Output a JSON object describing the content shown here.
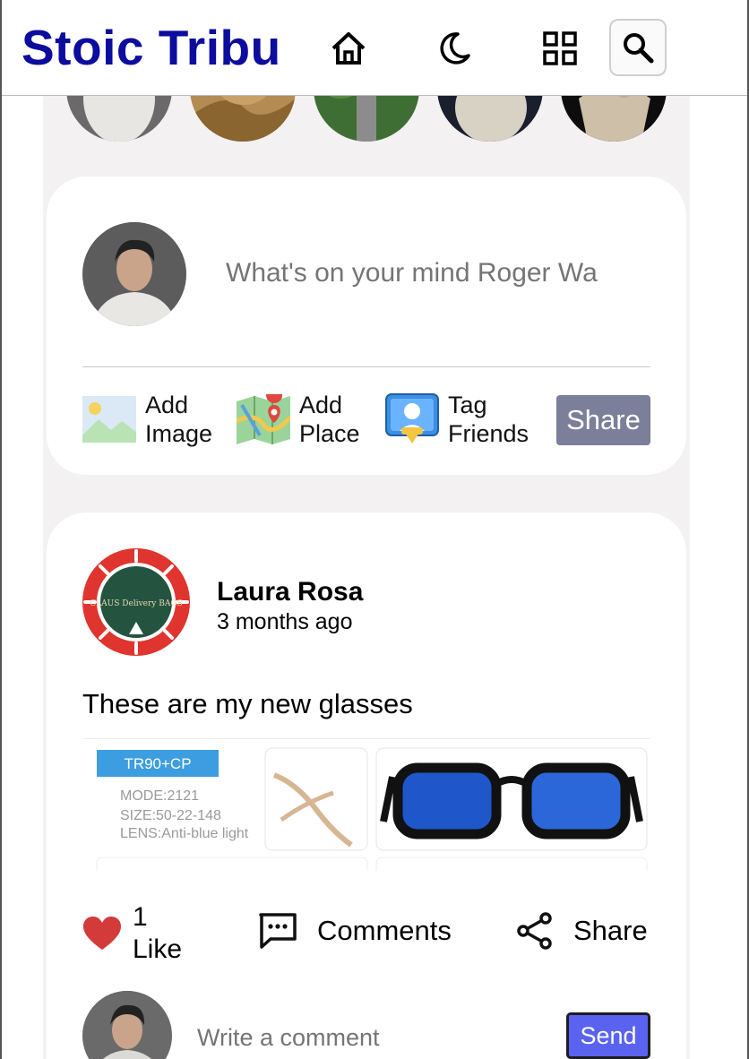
{
  "header": {
    "brand": "Stoic Tribu",
    "icons": [
      "home-icon",
      "moon-icon",
      "grid-icon",
      "search-icon"
    ]
  },
  "stories": {
    "count": 5
  },
  "composer": {
    "placeholder": "What's on your mind Roger Wa",
    "actions": [
      {
        "line1": "Add",
        "line2": "Image",
        "icon": "image-icon"
      },
      {
        "line1": "Add",
        "line2": "Place",
        "icon": "map-icon"
      },
      {
        "line1": "Tag",
        "line2": "Friends",
        "icon": "tag-friends-icon"
      }
    ],
    "share_label": "Share"
  },
  "post": {
    "author": "Laura Rosa",
    "time": "3 months ago",
    "text": "These are my new glasses",
    "logo_text": "CLAUS Delivery BAGS",
    "image": {
      "badge": "TR90+CP",
      "spec_mode": "MODE:2121",
      "spec_size": "SIZE:50-22-148",
      "spec_lens": "LENS:Anti-blue light"
    },
    "like_count": "1",
    "like_label": "Like",
    "comments_label": "Comments",
    "share_label": "Share",
    "comment_placeholder": "Write a comment",
    "send_label": "Send"
  },
  "colors": {
    "brand": "#0c0c9e",
    "share_button": "#7c7f9a",
    "send_button": "#5a63ef",
    "like_heart": "#d33a3a"
  }
}
